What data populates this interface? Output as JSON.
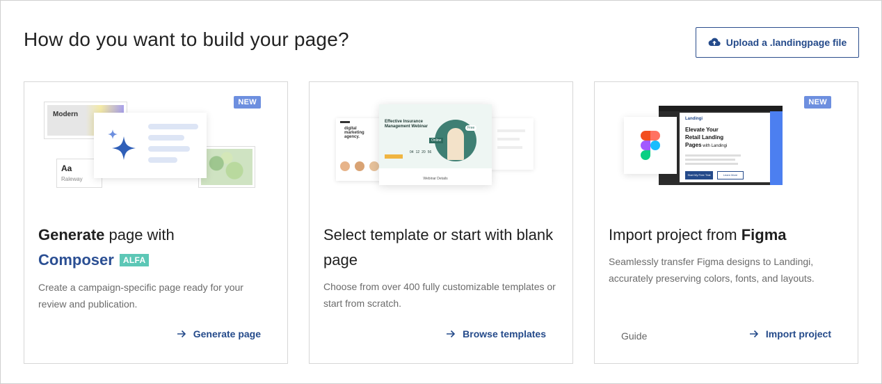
{
  "header": {
    "title": "How do you want to build your page?",
    "upload_label": "Upload a .landingpage file",
    "upload_icon": "cloud-upload-icon"
  },
  "cards": [
    {
      "badge": "NEW",
      "title_bold": "Generate",
      "title_rest": " page with",
      "title_brand": "Composer",
      "title_tag": "ALFA",
      "description": "Create a campaign-specific page ready for your review and publication.",
      "action_label": "Generate page",
      "illustration": {
        "font_card_title": "Modern",
        "font_sample": "Aa",
        "font_name": "Raleway"
      }
    },
    {
      "title": "Select template or start with blank page",
      "description": "Choose from over 400 fully customizable templates or start from scratch.",
      "action_label": "Browse templates",
      "illustration": {
        "left_heading": "digital marketing agency.",
        "main_heading": "Effective Insurance Management Webinar",
        "badge_text": "Free",
        "online_text": "Online",
        "countdown": [
          "04",
          "12",
          "20",
          "56"
        ],
        "footer_text": "Webinar Details"
      }
    },
    {
      "badge": "NEW",
      "title_regular": "Import project from ",
      "title_bold": "Figma",
      "description": "Seamlessly transfer Figma designs to Landingi, accurately preserving colors, fonts, and layouts.",
      "guide_label": "Guide",
      "action_label": "Import project",
      "illustration": {
        "brand": "Landingi",
        "heading_line1": "Elevate Your",
        "heading_line2": "Retail Landing",
        "heading_line3_bold": "Pages",
        "heading_line3_rest": " with Landingi",
        "primary_btn": "Start My Free Trial",
        "secondary_btn": "Learn More"
      }
    }
  ],
  "colors": {
    "accent": "#244a8a",
    "badge_new": "#6d8fdf",
    "badge_alfa": "#5cc7b6",
    "star": "#2f5fb8"
  }
}
